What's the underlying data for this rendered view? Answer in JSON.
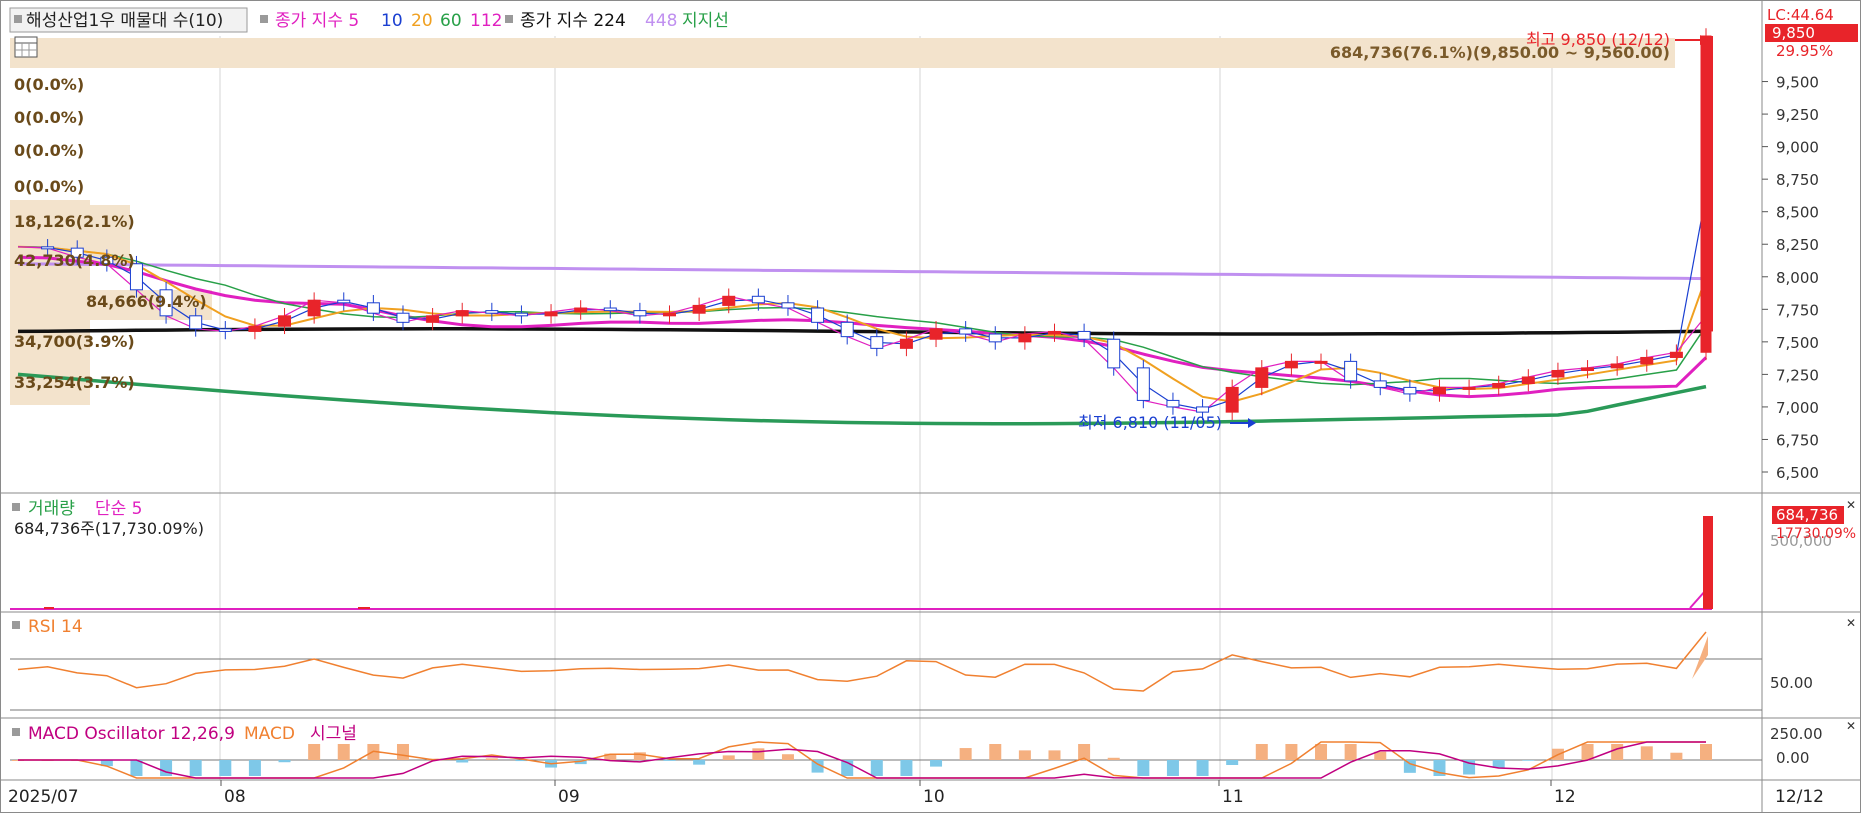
{
  "header": {
    "stock_title": "해성산업1우 매물대 수(10)",
    "close_index_label": "종가 지수 5",
    "ma_periods": [
      "10",
      "20",
      "60",
      "112"
    ],
    "close_index_label2": "종가 지수 224",
    "ma_448": "448",
    "support_label": "지지선"
  },
  "price_panel": {
    "high_note": "최고 9,850 (12/12)",
    "low_note": "최저 6,810 (11/05)",
    "top_band_text": "684,736(76.1%)(9,850.00 ~ 9,560.00)",
    "volume_profile_labels": [
      "0(0.0%)",
      "0(0.0%)",
      "0(0.0%)",
      "0(0.0%)",
      "18,126(2.1%)",
      "42,730(4.8%)",
      "84,666(9.4%)",
      "34,700(3.9%)",
      "33,254(3.7%)"
    ],
    "axis_ticks": [
      "9,500",
      "9,250",
      "9,000",
      "8,750",
      "8,500",
      "8,250",
      "8,000",
      "7,750",
      "7,500",
      "7,250",
      "7,000",
      "6,750",
      "6,500"
    ],
    "top_right_lc": "LC:44.64",
    "last_price_badge": "9,850",
    "last_change": "29.95%"
  },
  "volume_panel": {
    "title": "거래량",
    "ma_label": "단순 5",
    "summary": "684,736주(17,730.09%)",
    "badge_value": "684,736",
    "badge_pct": "17730.09%",
    "axis_label": "500,000"
  },
  "rsi_panel": {
    "title": "RSI 14",
    "axis_label": "50.00"
  },
  "macd_panel": {
    "title": "MACD Oscillator 12,26,9",
    "macd_label": "MACD",
    "signal_label": "시그널",
    "axis_labels": [
      "250.00",
      "0.00"
    ]
  },
  "x_axis": {
    "labels": [
      "2025/07",
      "08",
      "09",
      "10",
      "11",
      "12"
    ],
    "right_date": "12/12"
  },
  "colors": {
    "up": "#e8242a",
    "down": "#1a3fd1",
    "ma5": "#e020c0",
    "ma10": "#1a3fd1",
    "ma20": "#f0a020",
    "ma60": "#28a048",
    "ma112": "#e020c0",
    "ma224": "#111111",
    "ma448": "#c090f0",
    "support": "#2a9a58",
    "volume_profile": "#f3e3cc",
    "rsi": "#f08030",
    "macd": "#f08030",
    "signal": "#c00080",
    "osc_bar": "#7ec8e8"
  },
  "chart_data": {
    "type": "candlestick",
    "x_labels": [
      "2025/07",
      "08",
      "09",
      "10",
      "11",
      "12"
    ],
    "ylim": [
      6400,
      9850
    ],
    "high": 9850,
    "high_date": "12/12",
    "low": 6810,
    "low_date": "11/05",
    "close_trend": [
      8230,
      8220,
      8150,
      8100,
      7900,
      7700,
      7600,
      7580,
      7620,
      7700,
      7820,
      7800,
      7720,
      7650,
      7700,
      7740,
      7720,
      7700,
      7730,
      7760,
      7740,
      7700,
      7720,
      7780,
      7850,
      7800,
      7760,
      7650,
      7540,
      7450,
      7520,
      7600,
      7560,
      7500,
      7560,
      7580,
      7520,
      7300,
      7050,
      7000,
      6960,
      7150,
      7300,
      7350,
      7350,
      7200,
      7150,
      7100,
      7150,
      7150,
      7180,
      7230,
      7280,
      7300,
      7330,
      7380,
      7420,
      9850
    ]
  }
}
